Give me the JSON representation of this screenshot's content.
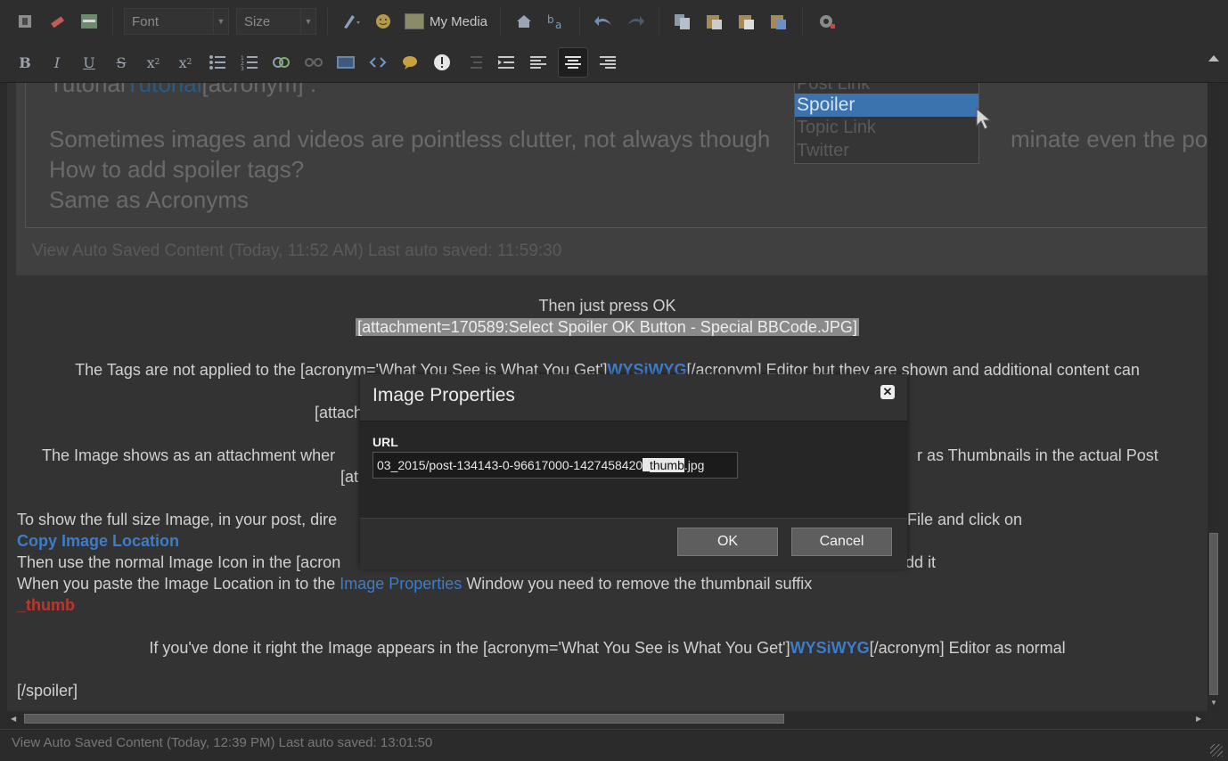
{
  "toolbar1": {
    "font_placeholder": "Font",
    "size_placeholder": "Size",
    "my_media_label": "My Media"
  },
  "editor": {
    "quote": {
      "line_partial_start": "Tutorial",
      "line_partial_link": "Tutorial",
      "line_partial_end": "[acronym] :",
      "line1": "Sometimes images and videos are pointless clutter, not always though",
      "line1_tail": "minate even the pointl",
      "line2": "How to add spoiler tags?",
      "line3": "Same as Acronyms",
      "autosave": "View Auto Saved Content (Today, 11:52 AM)  Last auto saved: 11:59:30",
      "dropdown": {
        "item_above": "Post Link",
        "selected": "Spoiler",
        "item1": "Topic Link",
        "item2": "Twitter"
      }
    },
    "then_press_ok": "Then just press OK",
    "attachment1": "[attachment=170589:Select Spoiler OK Button - Special BBCode.JPG]",
    "tags_line_start": "The Tags are not applied to the [acronym='What You See is What You Get']",
    "tags_line_link": "WYSiWYG",
    "tags_line_end": "[/acronym] Editor but they are shown and additional content can",
    "attach_partial": "[attach",
    "image_line_start": "The Image shows as an attachment wher",
    "image_line_end": "r as Thumbnails in the actual Post",
    "attach_partial2": "[at",
    "show_line_start": "To show the full size Image, in your post, dire",
    "show_line_end": "File and click on",
    "copy_image_location": "Copy Image Location",
    "then_use_start": "Then use the normal Image Icon in the [acron",
    "then_use_end": "dd it",
    "paste_start": "When you paste the Image Location in to the ",
    "paste_link": "Image Properties",
    "paste_end": " Window you need to remove the thumbnail suffix",
    "thumb_suffix": "_thumb",
    "done_start": "If you've done it right the Image appears in the [acronym='What You See is What You Get']",
    "done_link": "WYSiWYG",
    "done_end": "[/acronym] Editor as normal",
    "spoiler_close": "[/spoiler]"
  },
  "status": {
    "autosave": "View Auto Saved Content (Today, 12:39 PM)  Last auto saved: 13:01:50"
  },
  "dialog": {
    "title": "Image Properties",
    "url_label": "URL",
    "url_before": "03_2015/post-134143-0-96617000-1427458420",
    "url_selected": "_thumb",
    "url_after": ".jpg",
    "ok_label": "OK",
    "cancel_label": "Cancel"
  }
}
